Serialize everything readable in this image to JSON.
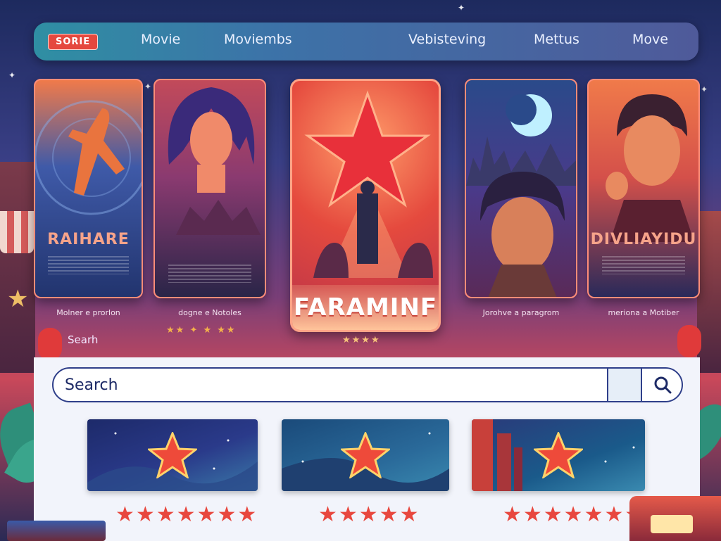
{
  "nav": {
    "logo": "SORIE",
    "items": [
      "Movie",
      "Moviembs",
      "Vebisteving",
      "Mettus",
      "Move"
    ]
  },
  "posters": [
    {
      "title": "RAIHARE",
      "caption": "Molner e prorlon",
      "stars": ""
    },
    {
      "title": "",
      "caption": "dogne e Notoles",
      "stars": "★★ ✦ ★ ★★"
    },
    {
      "title": "FARAMINF",
      "caption": "",
      "stars": "★★★★"
    },
    {
      "title": "",
      "caption": "Jorohve a paragrom",
      "stars": ""
    },
    {
      "title": "DIVLIAYIDU",
      "caption": "meriona a Motiber",
      "stars": ""
    }
  ],
  "overlay_search_label": "Searh",
  "search": {
    "placeholder": "Search"
  },
  "ratings": [
    "★★★★★★★",
    "★★★★★",
    "★★★★★★★"
  ],
  "colors": {
    "accent_red": "#e8473e",
    "nav_blue": "#3c73a8",
    "search_border": "#2f3f8a"
  },
  "icons": {
    "search": "magnifier-icon",
    "card": "star-icon"
  }
}
